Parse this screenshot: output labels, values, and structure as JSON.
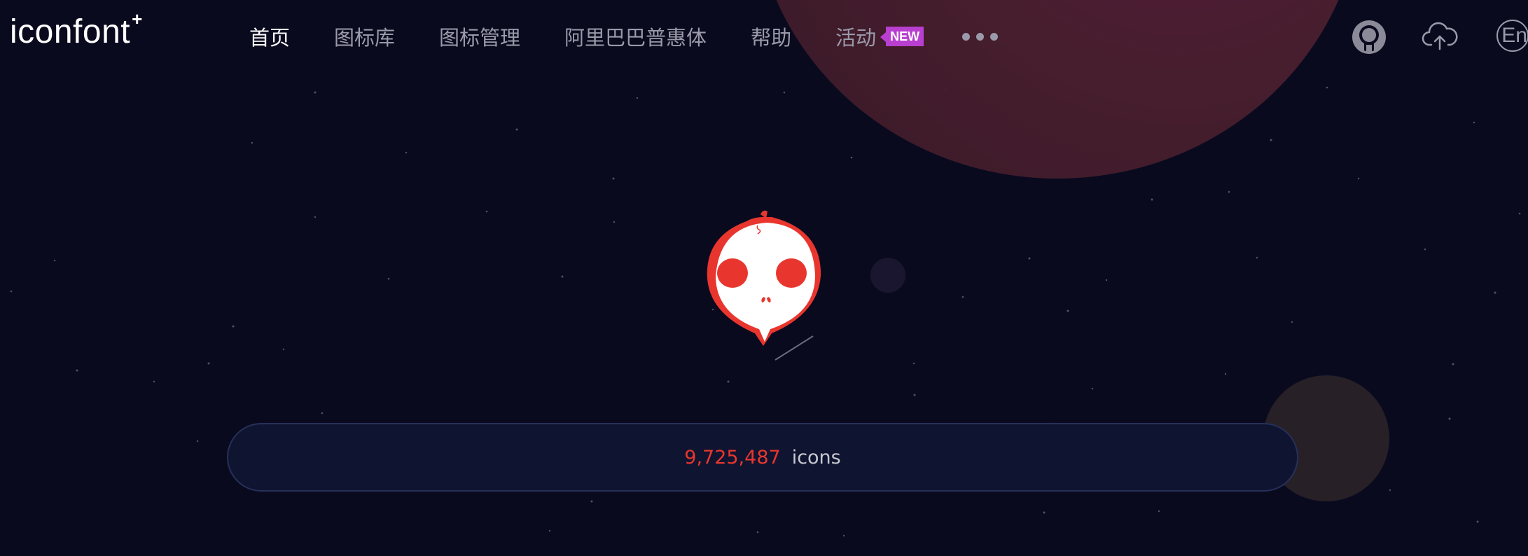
{
  "brand": {
    "name": "iconfont",
    "mark": "+"
  },
  "nav": {
    "items": [
      {
        "label": "首页",
        "active": true
      },
      {
        "label": "图标库",
        "active": false
      },
      {
        "label": "图标管理",
        "active": false
      },
      {
        "label": "阿里巴巴普惠体",
        "active": false
      },
      {
        "label": "帮助",
        "active": false
      },
      {
        "label": "活动",
        "active": false
      }
    ],
    "badge": "NEW",
    "more_icon": "more-dots-icon"
  },
  "toolbar": {
    "user_icon": "user-avatar-icon",
    "upload_icon": "cloud-upload-icon",
    "language_label": "En"
  },
  "hero": {
    "mascot_icon": "skull-mascot-icon",
    "icon_count": "9,725,487",
    "icon_count_label": "icons"
  },
  "colors": {
    "background": "#0a0a1f",
    "accent_red": "#e8362e",
    "badge_purple": "#b83fcf",
    "nav_inactive": "#9a9aaa",
    "nav_active": "#ffffff"
  }
}
